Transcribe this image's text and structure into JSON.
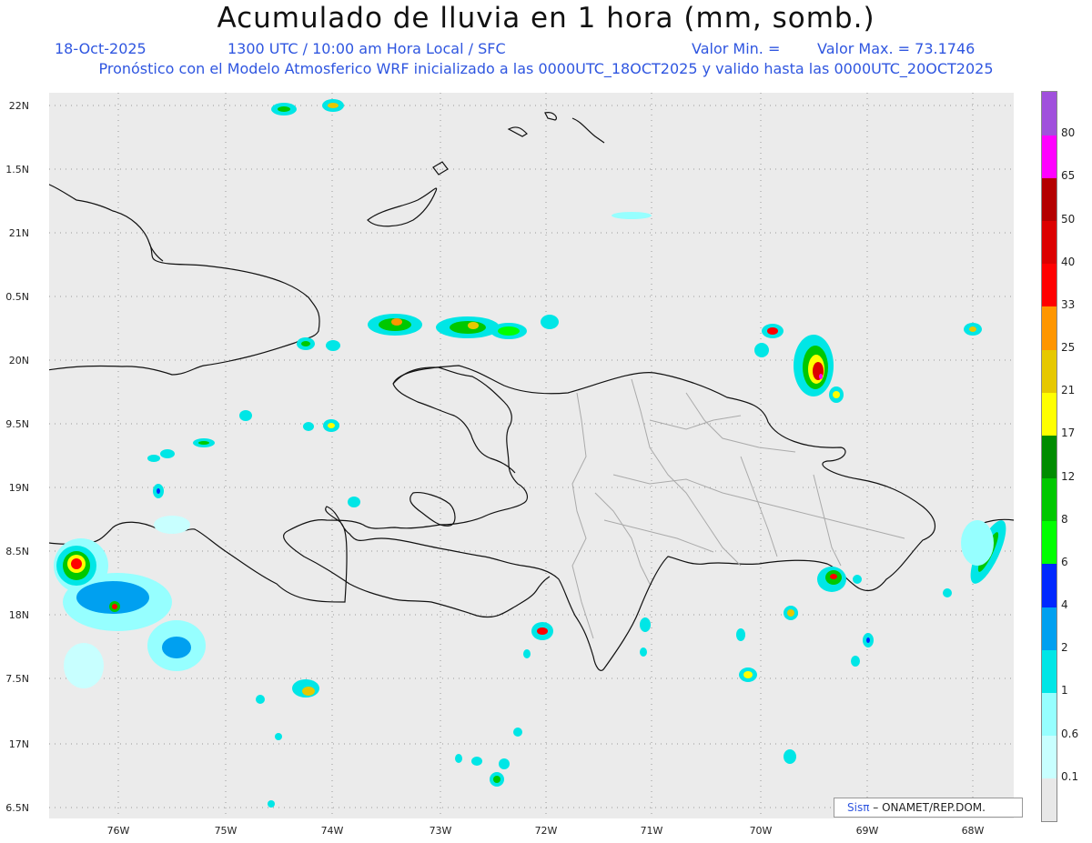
{
  "title": "Acumulado de lluvia en 1 hora (mm, somb.)",
  "subtitle": {
    "date": "18-Oct-2025",
    "time": "1300 UTC / 10:00 am Hora Local / SFC",
    "valor_min": "Valor Min. =",
    "valor_max": "Valor Max. = 73.1746"
  },
  "model_line": "Pronóstico con el Modelo Atmosferico WRF inicializado a las 0000UTC_18OCT2025 y valido hasta las  0000UTC_20OCT2025",
  "lat_labels": [
    "22N",
    "1.5N",
    "21N",
    "0.5N",
    "20N",
    "9.5N",
    "19N",
    "8.5N",
    "18N",
    "7.5N",
    "17N",
    "6.5N"
  ],
  "lon_labels": [
    "76W",
    "75W",
    "74W",
    "73W",
    "72W",
    "71W",
    "70W",
    "69W",
    "68W"
  ],
  "colorbar": {
    "labels": [
      "0.1",
      "0.6",
      "1",
      "2",
      "4",
      "6",
      "8",
      "12",
      "17",
      "21",
      "25",
      "33",
      "40",
      "50",
      "65",
      "80"
    ],
    "colors": [
      "#e8e8e8",
      "#c8ffff",
      "#96ffff",
      "#00e6e6",
      "#00a0f0",
      "#0028ff",
      "#00ff00",
      "#00c800",
      "#008c00",
      "#ffff00",
      "#e6c800",
      "#ff9600",
      "#ff0000",
      "#dc0000",
      "#b40000",
      "#ff00ff",
      "#a050dc"
    ]
  },
  "credit": {
    "brand": "Sisπ",
    "org": " – ONAMET/REP.DOM."
  }
}
